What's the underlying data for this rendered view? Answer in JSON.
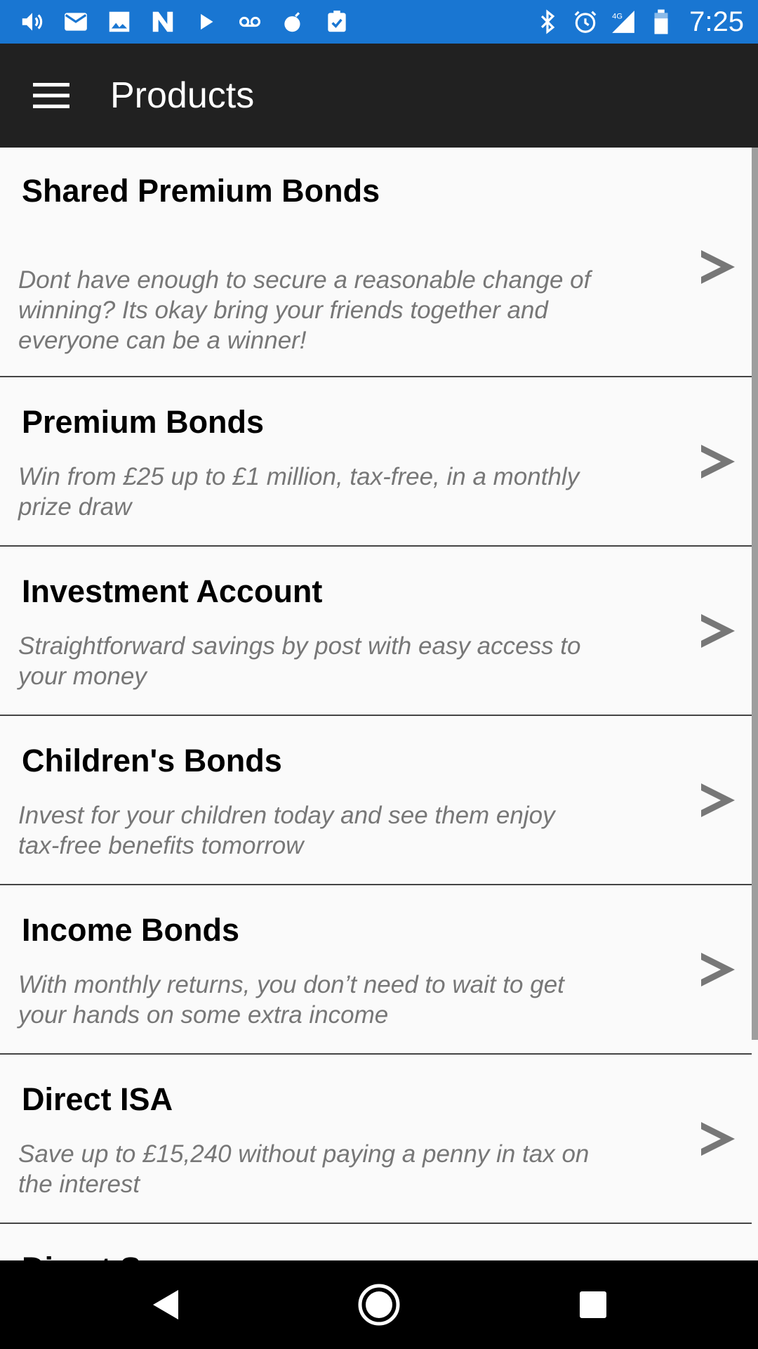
{
  "status_bar": {
    "left_icons": [
      "volume-icon",
      "mail-icon",
      "image-icon",
      "n-app-icon",
      "play-icon",
      "voicemail-icon",
      "bomb-app-icon",
      "clipboard-check-icon"
    ],
    "right_icons": [
      "bluetooth-icon",
      "alarm-icon",
      "signal-4g-icon",
      "battery-icon"
    ],
    "network": "4G",
    "time": "7:25"
  },
  "app_bar": {
    "title": "Products"
  },
  "products": [
    {
      "title": "Shared Premium Bonds",
      "description": "Dont have enough to secure a reasonable change of winning? Its okay bring your friends together and everyone can be a winner!"
    },
    {
      "title": "Premium Bonds",
      "description": "Win from £25 up to £1 million, tax-free, in a monthly prize draw"
    },
    {
      "title": "Investment Account",
      "description": "Straightforward savings by post with easy access to your money"
    },
    {
      "title": "Children's Bonds",
      "description": "Invest for your children today and see them enjoy tax-free benefits tomorrow"
    },
    {
      "title": "Income Bonds",
      "description": "With monthly returns, you don’t need to wait to get your hands on some extra income"
    },
    {
      "title": "Direct ISA",
      "description": "Save up to £15,240 without paying a penny in tax on the interest"
    },
    {
      "title": "Direct Saver",
      "description": ""
    }
  ],
  "colors": {
    "status_bar": "#1976d2",
    "app_bar": "#212121",
    "background": "#fafafa",
    "description": "#777777",
    "chevron": "#777777"
  }
}
